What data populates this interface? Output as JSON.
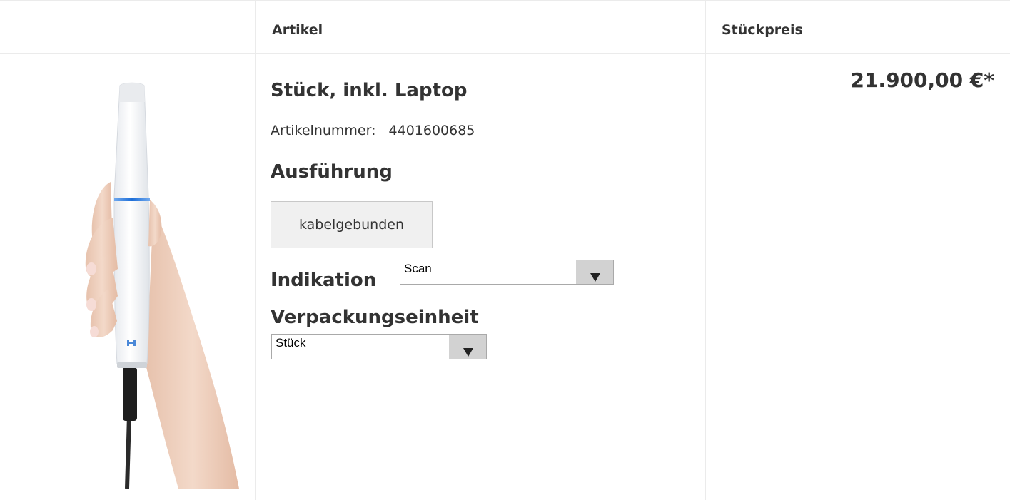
{
  "table": {
    "header_article": "Artikel",
    "header_unit_price": "Stückpreis"
  },
  "product": {
    "title": "Stück, inkl. Laptop",
    "article_number_label": "Artikelnummer:",
    "article_number": "4401600685",
    "price": "21.900,00 €*",
    "image_icon": "intraoral-scanner-in-hand-image"
  },
  "options": {
    "execution_label": "Ausführung",
    "execution_value": "kabelgebunden",
    "indication_label": "Indikation",
    "indication_selected": "Scan",
    "packaging_label": "Verpackungseinheit",
    "packaging_selected": "Stück"
  },
  "colors": {
    "text": "#333333",
    "divider": "#ebebeb",
    "button_bg": "#f0f0f0",
    "select_arrow_bg": "#d2d2d2",
    "scanner_accent": "#2f7fe0"
  }
}
